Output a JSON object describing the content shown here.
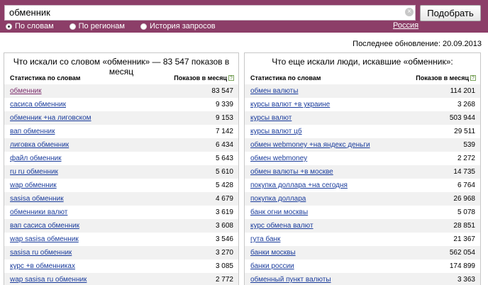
{
  "search": {
    "value": "обменник",
    "clear_glyph": "×",
    "button_label": "Подобрать"
  },
  "modes": [
    {
      "label": "По словам",
      "checked": true
    },
    {
      "label": "По регионам",
      "checked": false
    },
    {
      "label": "История запросов",
      "checked": false
    }
  ],
  "region": "Россия",
  "updated": "Последнее обновление: 20.09.2013",
  "left_panel": {
    "title": "Что искали со словом «обменник» — 83 547 показов в месяц",
    "col_query": "Статистика по словам",
    "col_count": "Показов в месяц",
    "rows": [
      {
        "q": "обменник",
        "n": "83 547"
      },
      {
        "q": "сасиса обменник",
        "n": "9 339"
      },
      {
        "q": "обменник +на лиговском",
        "n": "9 153"
      },
      {
        "q": "вап обменник",
        "n": "7 142"
      },
      {
        "q": "лиговка обменник",
        "n": "6 434"
      },
      {
        "q": "файл обменник",
        "n": "5 643"
      },
      {
        "q": "ru ru обменник",
        "n": "5 610"
      },
      {
        "q": "wap обменник",
        "n": "5 428"
      },
      {
        "q": "sasisa обменник",
        "n": "4 679"
      },
      {
        "q": "обменники валют",
        "n": "3 619"
      },
      {
        "q": "вап сасиса обменник",
        "n": "3 608"
      },
      {
        "q": "wap sasisa обменник",
        "n": "3 546"
      },
      {
        "q": "sasisa ru обменник",
        "n": "3 270"
      },
      {
        "q": "курс +в обменниках",
        "n": "3 085"
      },
      {
        "q": "wap sasisa ru обменник",
        "n": "2 772"
      }
    ]
  },
  "right_panel": {
    "title": "Что еще искали люди, искавшие «обменник»:",
    "col_query": "Статистика по словам",
    "col_count": "Показов в месяц",
    "rows": [
      {
        "q": "обмен валюты",
        "n": "114 201"
      },
      {
        "q": "курсы валют +в украине",
        "n": "3 268"
      },
      {
        "q": "курсы валют",
        "n": "503 944"
      },
      {
        "q": "курсы валют цб",
        "n": "29 511"
      },
      {
        "q": "обмен webmoney +на яндекс деньги",
        "n": "539"
      },
      {
        "q": "обмен webmoney",
        "n": "2 272"
      },
      {
        "q": "обмен валюты +в москве",
        "n": "14 735"
      },
      {
        "q": "покупка доллара +на сегодня",
        "n": "6 764"
      },
      {
        "q": "покупка доллара",
        "n": "26 968"
      },
      {
        "q": "банк огни москвы",
        "n": "5 078"
      },
      {
        "q": "курс обмена валют",
        "n": "28 851"
      },
      {
        "q": "гута банк",
        "n": "21 367"
      },
      {
        "q": "банки москвы",
        "n": "562 054"
      },
      {
        "q": "банки россии",
        "n": "174 899"
      },
      {
        "q": "обменный пункт валюты",
        "n": "3 363"
      }
    ]
  }
}
